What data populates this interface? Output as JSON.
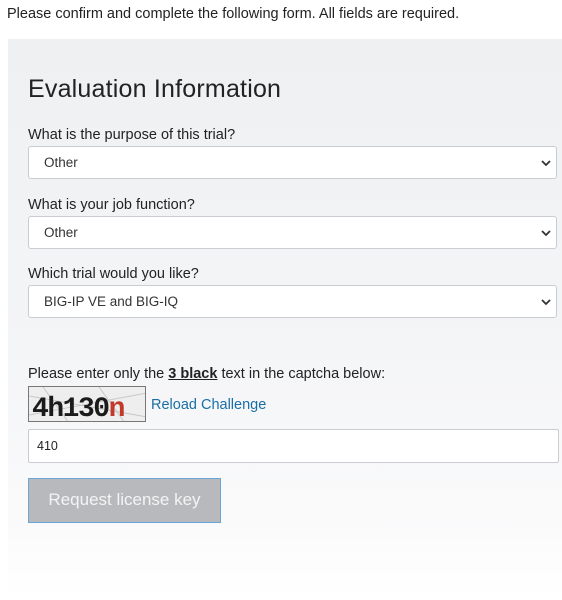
{
  "intro": "Please confirm and complete the following form. All fields are required.",
  "form": {
    "heading": "Evaluation Information",
    "purpose": {
      "label": "What is the purpose of this trial?",
      "value": "Other"
    },
    "job": {
      "label": "What is your job function?",
      "value": "Other"
    },
    "trial": {
      "label": "Which trial would you like?",
      "value": "BIG-IP VE and BIG-IQ"
    },
    "captcha": {
      "prompt_before": "Please enter only the ",
      "prompt_strong": "3 black",
      "prompt_after": " text in the captcha below:",
      "image_text": "4h130n",
      "reload_label": "Reload Challenge",
      "input_value": "410"
    },
    "submit_label": "Request license key"
  },
  "colors": {
    "link": "#1a6ea8",
    "button_bg": "#b7b9bc",
    "button_border": "#6aa6d8",
    "captcha_red": "#c0392b"
  }
}
